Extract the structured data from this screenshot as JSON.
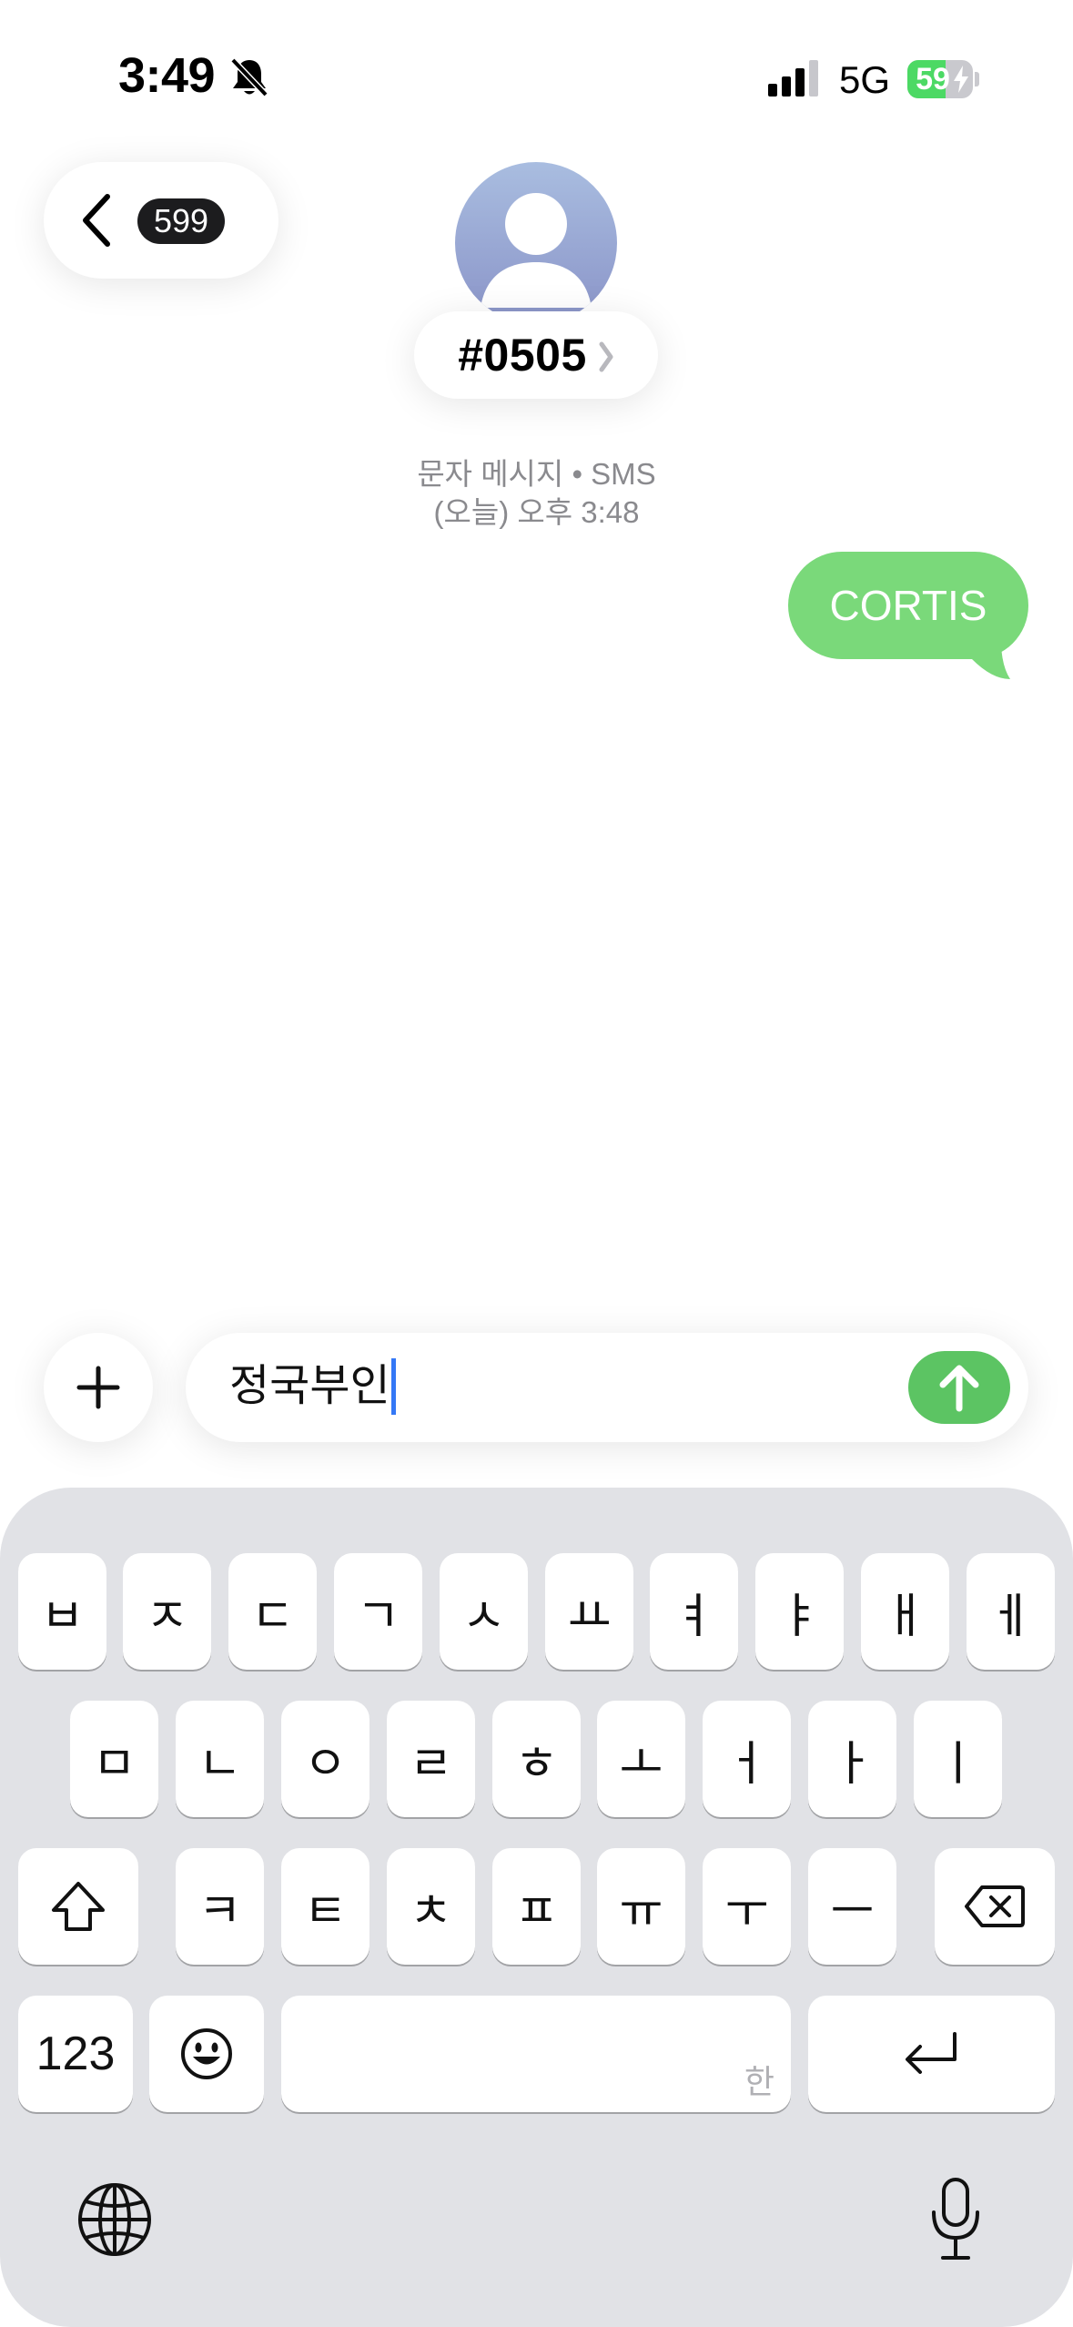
{
  "status_bar": {
    "time": "3:49",
    "network": "5G",
    "battery_level": "59",
    "battery_fraction": 0.59
  },
  "header": {
    "unread_count": "599",
    "contact_name": "#0505"
  },
  "conversation": {
    "meta_line1": "문자 메시지 • SMS",
    "meta_line2": "(오늘) 오후 3:48",
    "messages": [
      {
        "text": "CORTIS",
        "sender": "me"
      }
    ]
  },
  "compose": {
    "text": "정국부인"
  },
  "keyboard": {
    "row1": [
      "ㅂ",
      "ㅈ",
      "ㄷ",
      "ㄱ",
      "ㅅ",
      "ㅛ",
      "ㅕ",
      "ㅑ",
      "ㅐ",
      "ㅔ"
    ],
    "row2": [
      "ㅁ",
      "ㄴ",
      "ㅇ",
      "ㄹ",
      "ㅎ",
      "ㅗ",
      "ㅓ",
      "ㅏ",
      "ㅣ"
    ],
    "row3": [
      "ㅋ",
      "ㅌ",
      "ㅊ",
      "ㅍ",
      "ㅠ",
      "ㅜ",
      "ㅡ"
    ],
    "numbers_key": "123",
    "space_hint": "한"
  },
  "colors": {
    "bubble_green": "#7ad97a",
    "send_green": "#5cc463",
    "caret_blue": "#3478f6",
    "keyboard_bg": "#e1e2e6"
  },
  "icons": [
    "bell-slash-icon",
    "signal-icon",
    "battery-bolt-icon",
    "chevron-left-icon",
    "person-icon",
    "chevron-right-icon",
    "plus-icon",
    "arrow-up-icon",
    "shift-icon",
    "delete-icon",
    "emoji-icon",
    "return-icon",
    "globe-icon",
    "microphone-icon"
  ]
}
